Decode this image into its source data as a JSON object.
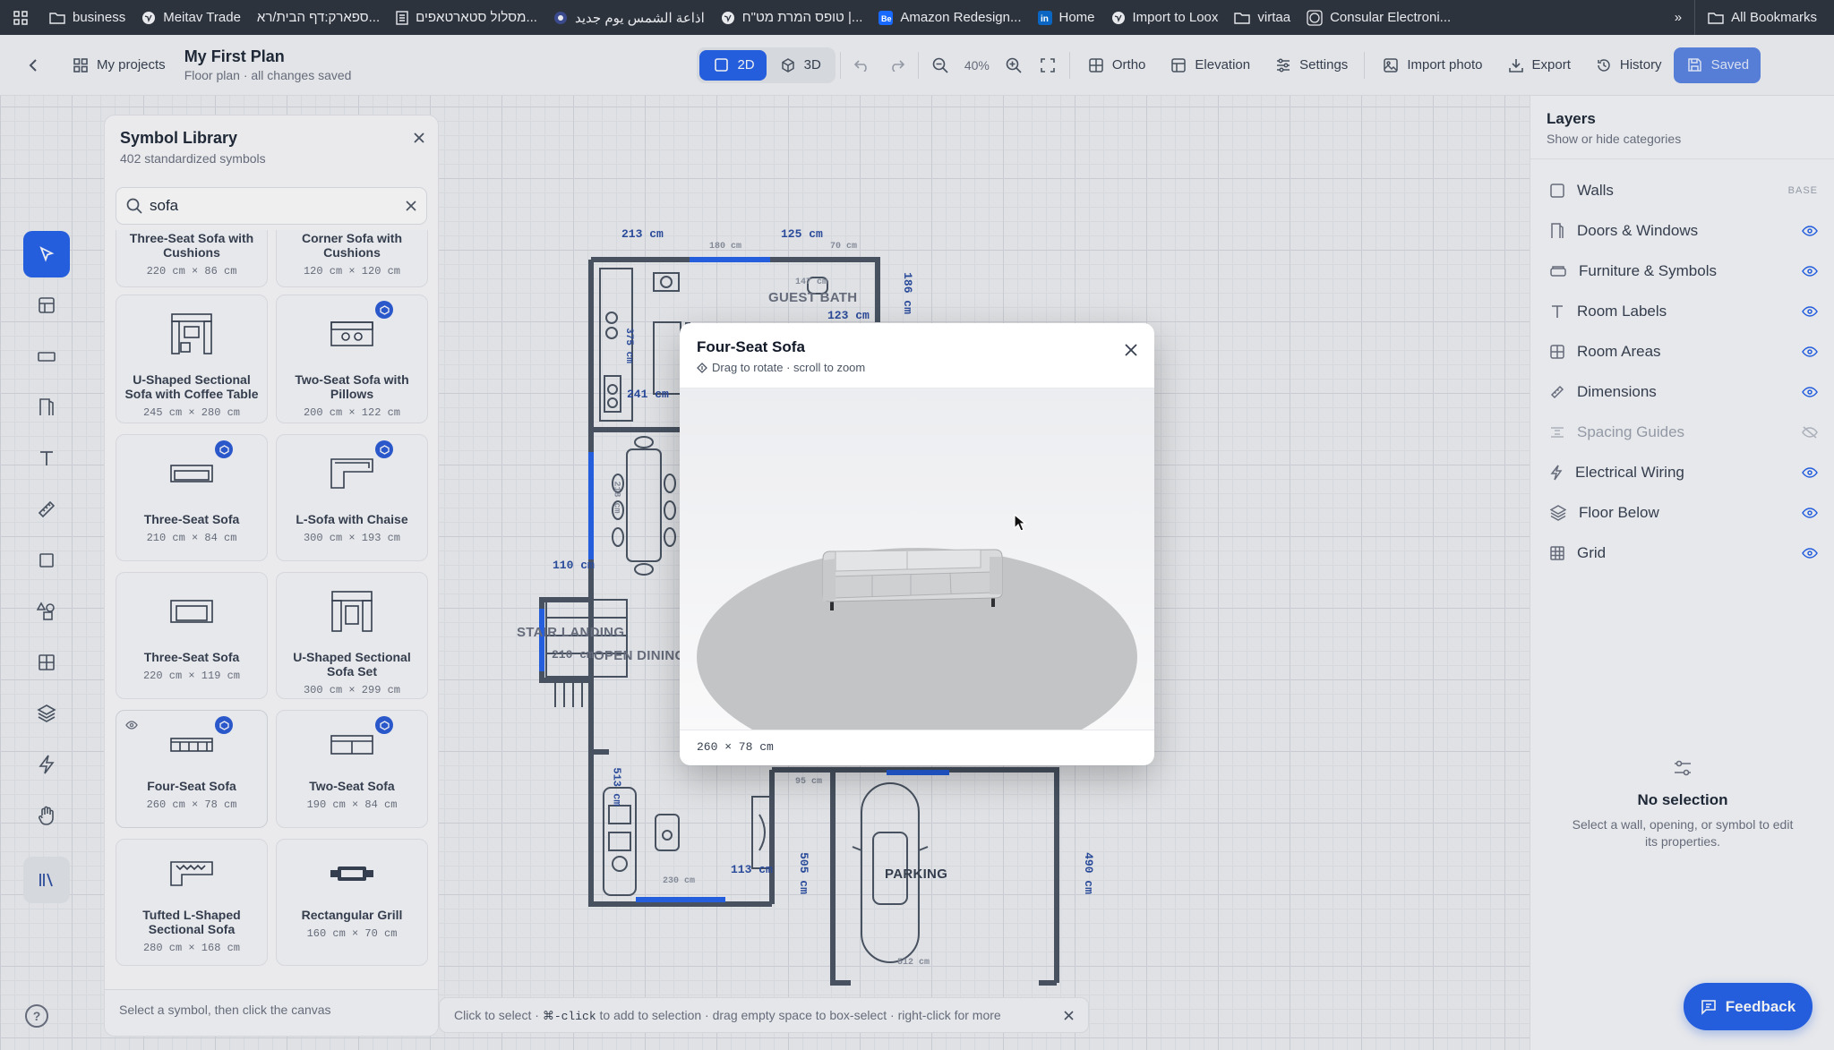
{
  "bookmarks": [
    {
      "label": "business",
      "icon": "folder-icon"
    },
    {
      "label": "Meitav Trade",
      "icon": "globe-icon"
    },
    {
      "label": "ספארק:דף הבית/רא...",
      "icon": "none"
    },
    {
      "label": "מסלול סטארטאפים...",
      "icon": "page-icon"
    },
    {
      "label": "اذاعة الشمس يوم جديد",
      "icon": "radio-icon"
    },
    {
      "label": "טופס המרת מט\"ח |...",
      "icon": "globe-icon"
    },
    {
      "label": "Amazon Redesign...",
      "icon": "behance-icon"
    },
    {
      "label": "Home",
      "icon": "linkedin-icon"
    },
    {
      "label": "Import to Loox",
      "icon": "globe-icon"
    },
    {
      "label": "virtaa",
      "icon": "folder-icon"
    },
    {
      "label": "Consular Electroni...",
      "icon": "seal-icon"
    }
  ],
  "all_bookmarks": "All Bookmarks",
  "toolbar": {
    "my_projects": "My projects",
    "title": "My First Plan",
    "subtitle": "Floor plan · all changes saved",
    "view_2d": "2D",
    "view_3d": "3D",
    "zoom": "40%",
    "ortho": "Ortho",
    "elevation": "Elevation",
    "settings": "Settings",
    "import_photo": "Import photo",
    "export": "Export",
    "history": "History",
    "saved": "Saved"
  },
  "library": {
    "title": "Symbol Library",
    "subtitle": "402 standardized symbols",
    "search_value": "sofa",
    "footer": "Select a symbol, then click the canvas",
    "cards": [
      {
        "name": "Three-Seat Sofa with Cushions",
        "dims": "220 cm × 86 cm"
      },
      {
        "name": "Corner Sofa with Cushions",
        "dims": "120 cm × 120 cm"
      },
      {
        "name": "U-Shaped Sectional Sofa with Coffee Table",
        "dims": "245 cm × 280 cm"
      },
      {
        "name": "Two-Seat Sofa with Pillows",
        "dims": "200 cm × 122 cm"
      },
      {
        "name": "Three-Seat Sofa",
        "dims": "210 cm × 84 cm"
      },
      {
        "name": "L-Sofa with Chaise",
        "dims": "300 cm × 193 cm"
      },
      {
        "name": "Three-Seat Sofa",
        "dims": "220 cm × 119 cm"
      },
      {
        "name": "U-Shaped Sectional Sofa Set",
        "dims": "300 cm × 299 cm"
      },
      {
        "name": "Four-Seat Sofa",
        "dims": "260 cm × 78 cm"
      },
      {
        "name": "Two-Seat Sofa",
        "dims": "190 cm × 84 cm"
      },
      {
        "name": "Tufted L-Shaped Sectional Sofa",
        "dims": "280 cm × 168 cm"
      },
      {
        "name": "Rectangular Grill",
        "dims": "160 cm × 70 cm"
      }
    ]
  },
  "plan": {
    "dims": {
      "d213": "213 cm",
      "d125": "125 cm",
      "d180": "180 cm",
      "d70": "70 cm",
      "d186": "186 cm",
      "d123": "123 cm",
      "d375": "375 cm",
      "d241": "241 cm",
      "d110": "110 cm",
      "d218": "218 cm",
      "d210": "210 cm",
      "d513": "513 cm",
      "d230": "230 cm",
      "d113": "113 cm",
      "d505": "505 cm",
      "d490": "490 cm",
      "d95": "95 cm",
      "d512": "512 cm",
      "d147": "147 cm"
    },
    "labels": {
      "guest_bath": "GUEST BATH",
      "stair_landing": "STAIR LANDING",
      "open_dining": "OPEN DINING",
      "parking": "PARKING"
    }
  },
  "status": {
    "before": "Click to select ·",
    "key": "⌘-click",
    "after": "to add to selection · drag empty space to box-select · right-click for more"
  },
  "layers": {
    "title": "Layers",
    "subtitle": "Show or hide categories",
    "base": "BASE",
    "items": [
      {
        "name": "Walls"
      },
      {
        "name": "Doors & Windows"
      },
      {
        "name": "Furniture & Symbols"
      },
      {
        "name": "Room Labels"
      },
      {
        "name": "Room Areas"
      },
      {
        "name": "Dimensions"
      },
      {
        "name": "Spacing Guides"
      },
      {
        "name": "Electrical Wiring"
      },
      {
        "name": "Floor Below"
      },
      {
        "name": "Grid"
      }
    ],
    "no_selection_title": "No selection",
    "no_selection_text": "Select a wall, opening, or symbol to edit its properties."
  },
  "feedback": "Feedback",
  "modal": {
    "title": "Four-Seat Sofa",
    "hint": "Drag to rotate · scroll to zoom",
    "dims": "260 × 78 cm"
  },
  "colors": {
    "accent": "#2563eb",
    "wall": "#4b5563",
    "window": "#2563eb",
    "topbar": "#2d333d"
  }
}
